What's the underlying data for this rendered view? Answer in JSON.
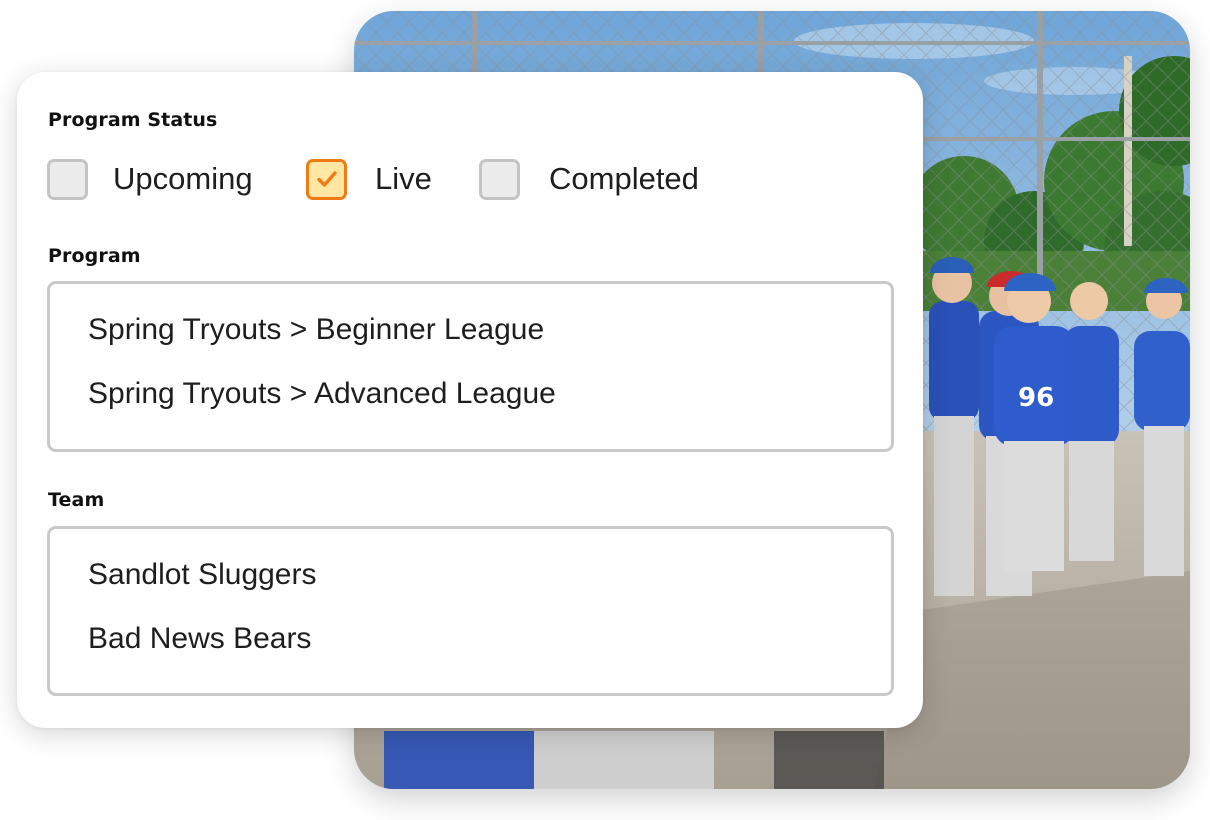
{
  "filters": {
    "program_status": {
      "label": "Program Status",
      "options": [
        {
          "label": "Upcoming",
          "checked": false
        },
        {
          "label": "Live",
          "checked": true
        },
        {
          "label": "Completed",
          "checked": false
        }
      ]
    },
    "program": {
      "label": "Program",
      "items": [
        "Spring Tryouts > Beginner League",
        "Spring Tryouts > Advanced League"
      ]
    },
    "team": {
      "label": "Team",
      "items": [
        "Sandlot Sluggers",
        "Bad News Bears"
      ]
    }
  },
  "colors": {
    "accent": "#f07a13",
    "checked_fill": "#ffe7a3",
    "unchecked_fill": "#ececec",
    "border": "#c9c9c9",
    "text": "#1e1e1e"
  },
  "icons": {
    "checkmark": "checkmark-icon"
  }
}
